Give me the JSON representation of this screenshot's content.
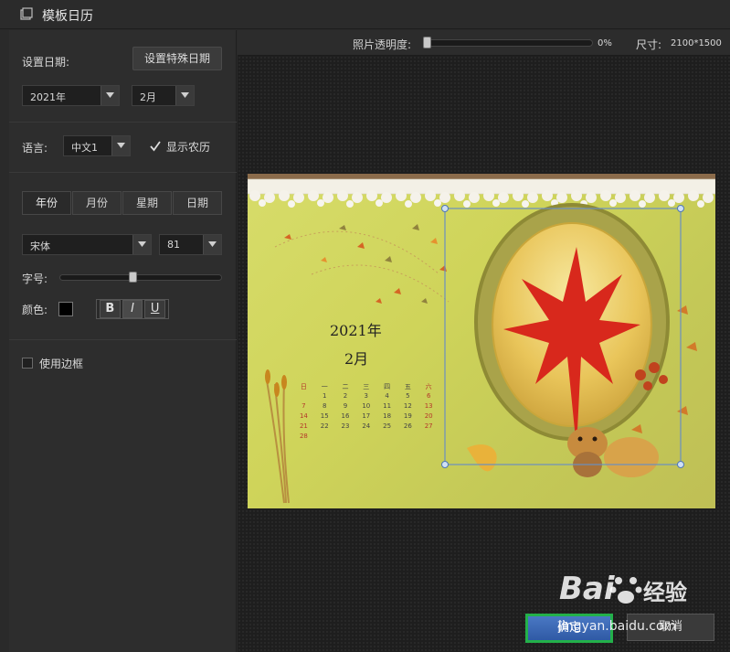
{
  "window": {
    "title": "模板日历"
  },
  "left": {
    "set_date_label": "设置日期:",
    "special_date_button": "设置特殊日期",
    "year_select": "2021年",
    "month_select": "2月",
    "language_label": "语言:",
    "language_select": "中文1",
    "show_lunar_label": "显示农历",
    "show_lunar_checked": true,
    "tabs": [
      "年份",
      "月份",
      "星期",
      "日期"
    ],
    "font_select": "宋体",
    "size_select": "81",
    "font_size_label": "字号:",
    "font_size_level": 0.45,
    "color_label": "颜色:",
    "color_value": "#000000",
    "bold_label": "B",
    "italic_label": "I",
    "underline_label": "U",
    "use_border_label": "使用边框",
    "use_border_checked": false
  },
  "toolbar": {
    "opacity_label": "照片透明度:",
    "opacity_value": "0%",
    "opacity_level": 0,
    "size_label": "尺寸:",
    "size_value": "2100*1500"
  },
  "calendar": {
    "year_text": "2021年",
    "month_text": "2月",
    "weekday_headers": [
      "日",
      "一",
      "二",
      "三",
      "四",
      "五",
      "六"
    ],
    "rows": [
      [
        "",
        "1",
        "2",
        "3",
        "4",
        "5",
        "6"
      ],
      [
        "7",
        "8",
        "9",
        "10",
        "11",
        "12",
        "13"
      ],
      [
        "14",
        "15",
        "16",
        "17",
        "18",
        "19",
        "20"
      ],
      [
        "21",
        "22",
        "23",
        "24",
        "25",
        "26",
        "27"
      ],
      [
        "28",
        "",
        "",
        "",
        "",
        "",
        ""
      ]
    ]
  },
  "buttons": {
    "ok": "确定",
    "cancel": "取消"
  },
  "watermark": {
    "brand": "Bai",
    "brand2": "经验",
    "url": "jingyan.baidu.com"
  },
  "colors": {
    "accent_blue": "#2f5aa5",
    "highlight_green": "#23b04a",
    "selection_blue": "#6a8fc0"
  }
}
